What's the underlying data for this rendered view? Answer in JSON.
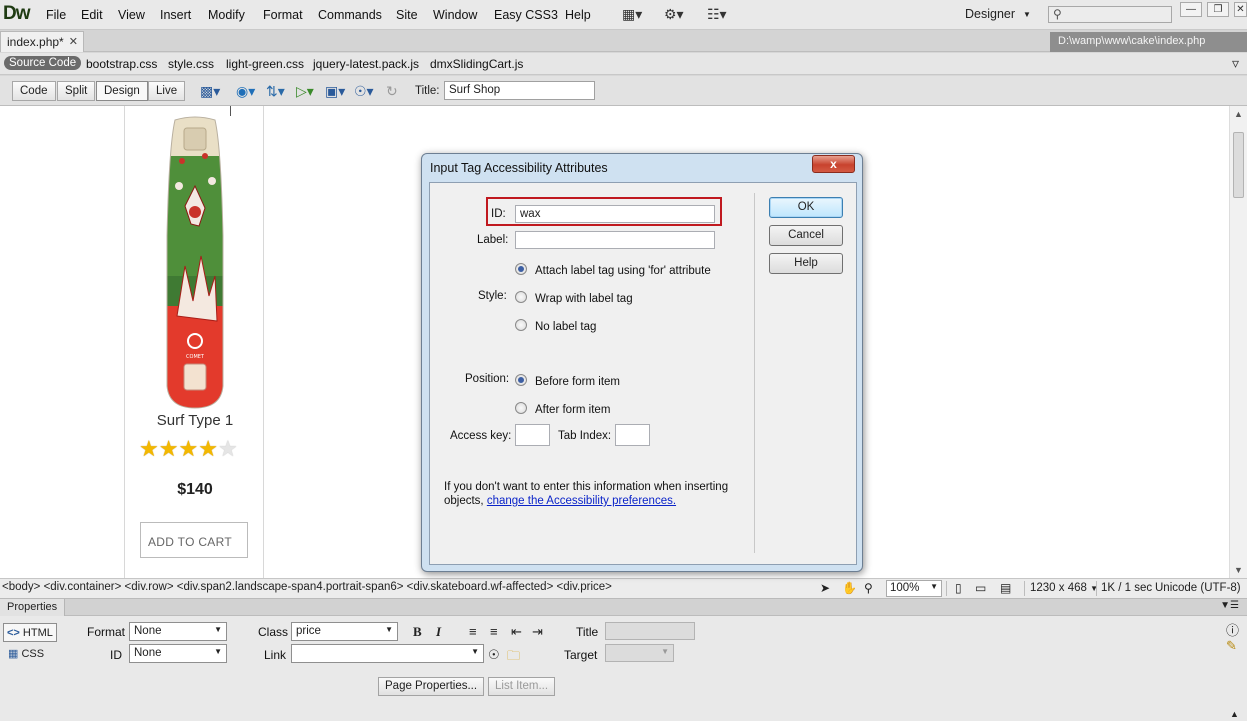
{
  "app": {
    "logo": "Dw",
    "menu": [
      "File",
      "Edit",
      "View",
      "Insert",
      "Modify",
      "Format",
      "Commands",
      "Site",
      "Window",
      "Easy CSS3",
      "Help"
    ],
    "workspace": "Designer",
    "window_buttons": [
      "minimize",
      "restore",
      "close"
    ]
  },
  "document": {
    "tab_label": "index.php*",
    "file_path": "D:\\wamp\\www\\cake\\index.php",
    "related_files": [
      "Source Code",
      "bootstrap.css",
      "style.css",
      "light-green.css",
      "jquery-latest.pack.js",
      "dmxSlidingCart.js"
    ],
    "views": [
      "Code",
      "Split",
      "Design",
      "Live"
    ],
    "active_view": "Design",
    "title_label": "Title:",
    "title_value": "Surf Shop"
  },
  "product": {
    "name": "Surf Type 1",
    "rating": 4,
    "rating_max": 5,
    "price": "$140",
    "add_to_cart": "ADD TO CART",
    "board_brand": "COMET"
  },
  "status_bar": {
    "tag_selector": "<body> <div.container> <div.row> <div.span2.landscape-span4.portrait-span6> <div.skateboard.wf-affected> <div.price>",
    "zoom": "100%",
    "window_size": "1230 x 468",
    "download": "1K / 1 sec",
    "encoding": "Unicode (UTF-8)"
  },
  "properties": {
    "panel_title": "Properties",
    "html_tab": "HTML",
    "css_tab": "CSS",
    "format_label": "Format",
    "format_value": "None",
    "class_label": "Class",
    "class_value": "price",
    "id_label": "ID",
    "id_value": "None",
    "link_label": "Link",
    "link_value": "",
    "title_label": "Title",
    "target_label": "Target",
    "bold": "B",
    "italic": "I",
    "page_properties": "Page Properties...",
    "list_item": "List Item..."
  },
  "dialog": {
    "title": "Input Tag Accessibility Attributes",
    "close": "x",
    "id_label": "ID:",
    "id_value": "wax",
    "label_label": "Label:",
    "label_value": "",
    "style_label": "Style:",
    "style_options": [
      "Attach label tag using 'for' attribute",
      "Wrap with label tag",
      "No label tag"
    ],
    "style_selected": 0,
    "position_label": "Position:",
    "position_options": [
      "Before form item",
      "After form item"
    ],
    "position_selected": 0,
    "access_key_label": "Access key:",
    "access_key_value": "",
    "tab_index_label": "Tab Index:",
    "tab_index_value": "",
    "note_text": "If you don't want to enter this information when inserting objects, ",
    "note_link": "change the Accessibility preferences.",
    "ok": "OK",
    "cancel": "Cancel",
    "help": "Help",
    "highlight_color": "#c0191f"
  }
}
